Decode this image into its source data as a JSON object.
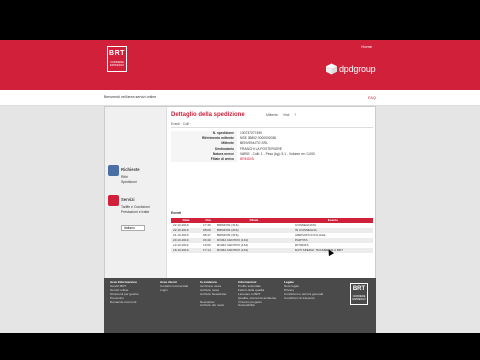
{
  "header": {
    "home_link": "Home",
    "brt_logo_main": "BRT",
    "brt_logo_sub": "CORRIERE ESPRESSO",
    "dpd_logo": "dpdgroup"
  },
  "nav": {
    "text": "Benvenuti nell'area servizi online",
    "right_link": "FAQ"
  },
  "sidebar": {
    "sections": [
      {
        "title": "Richieste",
        "icon": "globe-icon",
        "color": "#4a6fa5",
        "links": [
          "Ritiri",
          "Spedizioni"
        ]
      },
      {
        "title": "Servizi",
        "icon": "box-icon",
        "color": "#d0203a",
        "links": [
          "Tariffe e Condizioni",
          "Prestazioni e tratte"
        ]
      }
    ],
    "language": "Italiano"
  },
  "main": {
    "title": "Dettaglio della spedizione",
    "tabs": [
      "Mittente",
      "Visti",
      "?"
    ],
    "crumbs": "Eventi  ·  Colli  ·"
  },
  "details": [
    {
      "label": "N. spedizione",
      "value": "130737077490",
      "red": false
    },
    {
      "label": "Riferimento mittente",
      "value": "NSE 35802 0000000036",
      "red": false
    },
    {
      "label": "Mittente",
      "value": "BENVENUTO SRL",
      "red": false
    },
    {
      "label": "Destinatario",
      "value": "FRANCHI LA POSTERIORE",
      "red": false
    },
    {
      "label": "Natura merce",
      "value": "VARIE - Colli: 1 - Peso (kg): 5,1 - Volume m³: 0,000",
      "red": false
    },
    {
      "label": "Filiale di arrivo",
      "value": "BRINDISI",
      "red": true
    }
  ],
  "events": {
    "label": "Eventi",
    "columns": [
      "Data",
      "Ora",
      "Filiale",
      "Evento"
    ],
    "rows": [
      [
        "22.10.2019",
        "17:46",
        "BRINDISI (316)",
        "CONSEGNATA"
      ],
      [
        "22.10.2019",
        "08:09",
        "BRINDISI (316)",
        "IN CONSEGNA"
      ],
      [
        "21.10.2019",
        "08:47",
        "BRINDISI (316)",
        "ARRIVATA IN FILIALE"
      ],
      [
        "20.10.2019",
        "03:40",
        "ROMA CENTRO (134)",
        "PARTITA"
      ],
      [
        "19.10.2019",
        "19:06",
        "ROMA CENTRO (134)",
        "RITIRATA"
      ],
      [
        "18.10.2019",
        "17:14",
        "ROMA CENTRO (134)",
        "DATI SPEDIZ. TRASMESSI A BRT"
      ]
    ]
  },
  "footer": {
    "cols": [
      {
        "head": "Area Informazione",
        "items": [
          "Servizi BRT",
          "Servizi online",
          "Strumenti per gestire",
          "Preventivi",
          "Domande ricorrenti"
        ]
      },
      {
        "head": "Area clienti",
        "items": [
          "Contatti commerciali",
          "Login"
        ]
      },
      {
        "head": "In evidenza",
        "items": [
          "Iscrizione news",
          "Archivio news",
          "Archivio Newsletter",
          "",
          "Newsletter",
          "Archivio dei news"
        ]
      },
      {
        "head": "Informazioni",
        "items": [
          "Profilo aziendale",
          "Fattori della qualità",
          "Lavorare in BRT",
          "Qualità, sicurezza ambiente",
          "Il Nostro progetto",
          "Sostenibilità"
        ]
      },
      {
        "head": "Legale",
        "items": [
          "Note legali",
          "Privacy",
          "Condizioni e termini generali",
          "Condizioni di trasporto"
        ]
      }
    ],
    "logo_main": "BRT",
    "logo_sub": "CORRIERE ESPRESSO"
  }
}
